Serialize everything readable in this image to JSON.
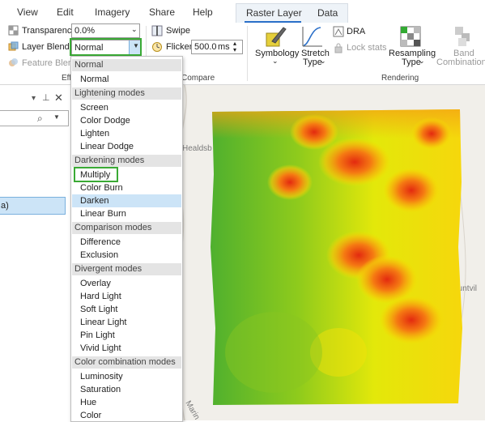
{
  "tabs": {
    "view": "View",
    "edit": "Edit",
    "imagery": "Imagery",
    "share": "Share",
    "help": "Help",
    "raster_layer": "Raster Layer",
    "data": "Data"
  },
  "ribbon": {
    "transparency_label": "Transparency",
    "transparency_value": "0.0%",
    "layer_blend_label": "Layer Blend",
    "layer_blend_value": "Normal",
    "feature_blend_label": "Feature Blend",
    "effects_group": "Eff",
    "swipe": "Swipe",
    "flicker": "Flicker",
    "flicker_value": "500.0",
    "flicker_unit": "ms",
    "compare_group": "Compare",
    "symbology": "Symbology",
    "stretch_type_1": "Stretch",
    "stretch_type_2": "Type",
    "dra": "DRA",
    "lock_stats": "Lock stats",
    "resampling_1": "Resampling",
    "resampling_2": "Type",
    "band_1": "Band",
    "band_2": "Combination",
    "rendering_group": "Rendering"
  },
  "left_panel": {
    "selected_item": "a)"
  },
  "map_labels": {
    "healdsburg": "Healdsb",
    "suntvill": "Suntvil",
    "marin": "Marin"
  },
  "blend_menu": {
    "groups": [
      {
        "header": "Normal",
        "items": [
          "Normal"
        ]
      },
      {
        "header": "Lightening modes",
        "items": [
          "Screen",
          "Color Dodge",
          "Lighten",
          "Linear Dodge"
        ]
      },
      {
        "header": "Darkening modes",
        "items": [
          "Multiply",
          "Color Burn",
          "Darken",
          "Linear Burn"
        ]
      },
      {
        "header": "Comparison modes",
        "items": [
          "Difference",
          "Exclusion"
        ]
      },
      {
        "header": "Divergent modes",
        "items": [
          "Overlay",
          "Hard Light",
          "Soft Light",
          "Linear Light",
          "Pin Light",
          "Vivid Light"
        ]
      },
      {
        "header": "Color combination modes",
        "items": [
          "Luminosity",
          "Saturation",
          "Hue",
          "Color"
        ]
      }
    ],
    "hovered_item": "Darken",
    "highlighted_item": "Multiply"
  },
  "colors": {
    "accent_blue": "#2a6fc8",
    "highlight_green": "#3aaa35",
    "hover_blue": "#cce4f7"
  }
}
